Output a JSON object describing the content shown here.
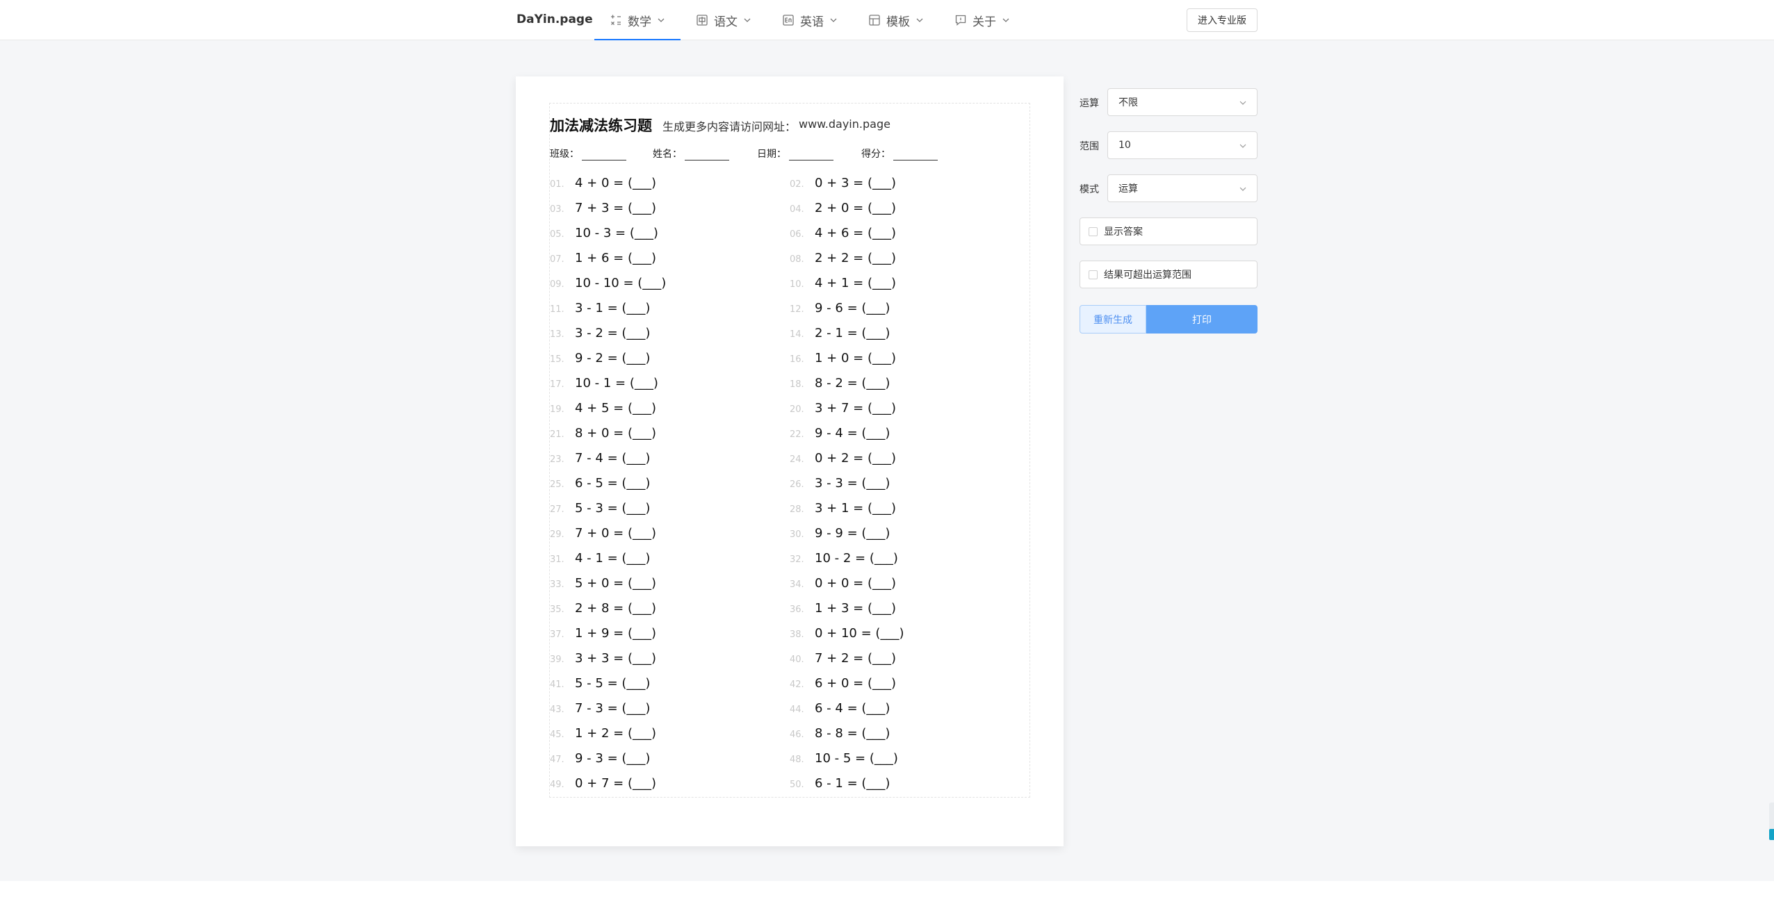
{
  "header": {
    "logo": "DaYin.page",
    "nav": [
      {
        "label": "数学",
        "icon": "math-icon",
        "active": true
      },
      {
        "label": "语文",
        "icon": "chinese-char-icon",
        "active": false
      },
      {
        "label": "英语",
        "icon": "english-icon",
        "active": false
      },
      {
        "label": "模板",
        "icon": "template-icon",
        "active": false
      },
      {
        "label": "关于",
        "icon": "about-icon",
        "active": false
      }
    ],
    "pro_button": "进入专业版"
  },
  "sheet": {
    "title": "加法减法练习题",
    "subtitle": "生成更多内容请访问网址：",
    "url": "www.dayin.page",
    "fields": [
      "班级：",
      "姓名：",
      "日期：",
      "得分："
    ],
    "questions": [
      {
        "num": "01.",
        "expr": "4 + 0 = "
      },
      {
        "num": "02.",
        "expr": "0 + 3 = "
      },
      {
        "num": "03.",
        "expr": "7 + 3 = "
      },
      {
        "num": "04.",
        "expr": "2 + 0 = "
      },
      {
        "num": "05.",
        "expr": "10 - 3 = "
      },
      {
        "num": "06.",
        "expr": "4 + 6 = "
      },
      {
        "num": "07.",
        "expr": "1 + 6 = "
      },
      {
        "num": "08.",
        "expr": "2 + 2 = "
      },
      {
        "num": "09.",
        "expr": "10 - 10 = "
      },
      {
        "num": "10.",
        "expr": "4 + 1 = "
      },
      {
        "num": "11.",
        "expr": "3 - 1 = "
      },
      {
        "num": "12.",
        "expr": "9 - 6 = "
      },
      {
        "num": "13.",
        "expr": "3 - 2 = "
      },
      {
        "num": "14.",
        "expr": "2 - 1 = "
      },
      {
        "num": "15.",
        "expr": "9 - 2 = "
      },
      {
        "num": "16.",
        "expr": "1 + 0 = "
      },
      {
        "num": "17.",
        "expr": "10 - 1 = "
      },
      {
        "num": "18.",
        "expr": "8 - 2 = "
      },
      {
        "num": "19.",
        "expr": "4 + 5 = "
      },
      {
        "num": "20.",
        "expr": "3 + 7 = "
      },
      {
        "num": "21.",
        "expr": "8 + 0 = "
      },
      {
        "num": "22.",
        "expr": "9 - 4 = "
      },
      {
        "num": "23.",
        "expr": "7 - 4 = "
      },
      {
        "num": "24.",
        "expr": "0 + 2 = "
      },
      {
        "num": "25.",
        "expr": "6 - 5 = "
      },
      {
        "num": "26.",
        "expr": "3 - 3 = "
      },
      {
        "num": "27.",
        "expr": "5 - 3 = "
      },
      {
        "num": "28.",
        "expr": "3 + 1 = "
      },
      {
        "num": "29.",
        "expr": "7 + 0 = "
      },
      {
        "num": "30.",
        "expr": "9 - 9 = "
      },
      {
        "num": "31.",
        "expr": "4 - 1 = "
      },
      {
        "num": "32.",
        "expr": "10 - 2 = "
      },
      {
        "num": "33.",
        "expr": "5 + 0 = "
      },
      {
        "num": "34.",
        "expr": "0 + 0 = "
      },
      {
        "num": "35.",
        "expr": "2 + 8 = "
      },
      {
        "num": "36.",
        "expr": "1 + 3 = "
      },
      {
        "num": "37.",
        "expr": "1 + 9 = "
      },
      {
        "num": "38.",
        "expr": "0 + 10 = "
      },
      {
        "num": "39.",
        "expr": "3 + 3 = "
      },
      {
        "num": "40.",
        "expr": "7 + 2 = "
      },
      {
        "num": "41.",
        "expr": "5 - 5 = "
      },
      {
        "num": "42.",
        "expr": "6 + 0 = "
      },
      {
        "num": "43.",
        "expr": "7 - 3 = "
      },
      {
        "num": "44.",
        "expr": "6 - 4 = "
      },
      {
        "num": "45.",
        "expr": "1 + 2 = "
      },
      {
        "num": "46.",
        "expr": "8 - 8 = "
      },
      {
        "num": "47.",
        "expr": "9 - 3 = "
      },
      {
        "num": "48.",
        "expr": "10 - 5 = "
      },
      {
        "num": "49.",
        "expr": "0 + 7 = "
      },
      {
        "num": "50.",
        "expr": "6 - 1 = "
      }
    ],
    "answer_blank": "(___)"
  },
  "panel": {
    "operation": {
      "label": "运算",
      "value": "不限"
    },
    "range": {
      "label": "范围",
      "value": "10"
    },
    "mode": {
      "label": "模式",
      "value": "运算"
    },
    "show_answer": "显示答案",
    "allow_overflow": "结果可超出运算范围",
    "regen": "重新生成",
    "print": "打印"
  },
  "colors": {
    "accent": "#1677ff",
    "print_button": "#5ea3f7",
    "regen_bg": "#e8f2ff"
  }
}
